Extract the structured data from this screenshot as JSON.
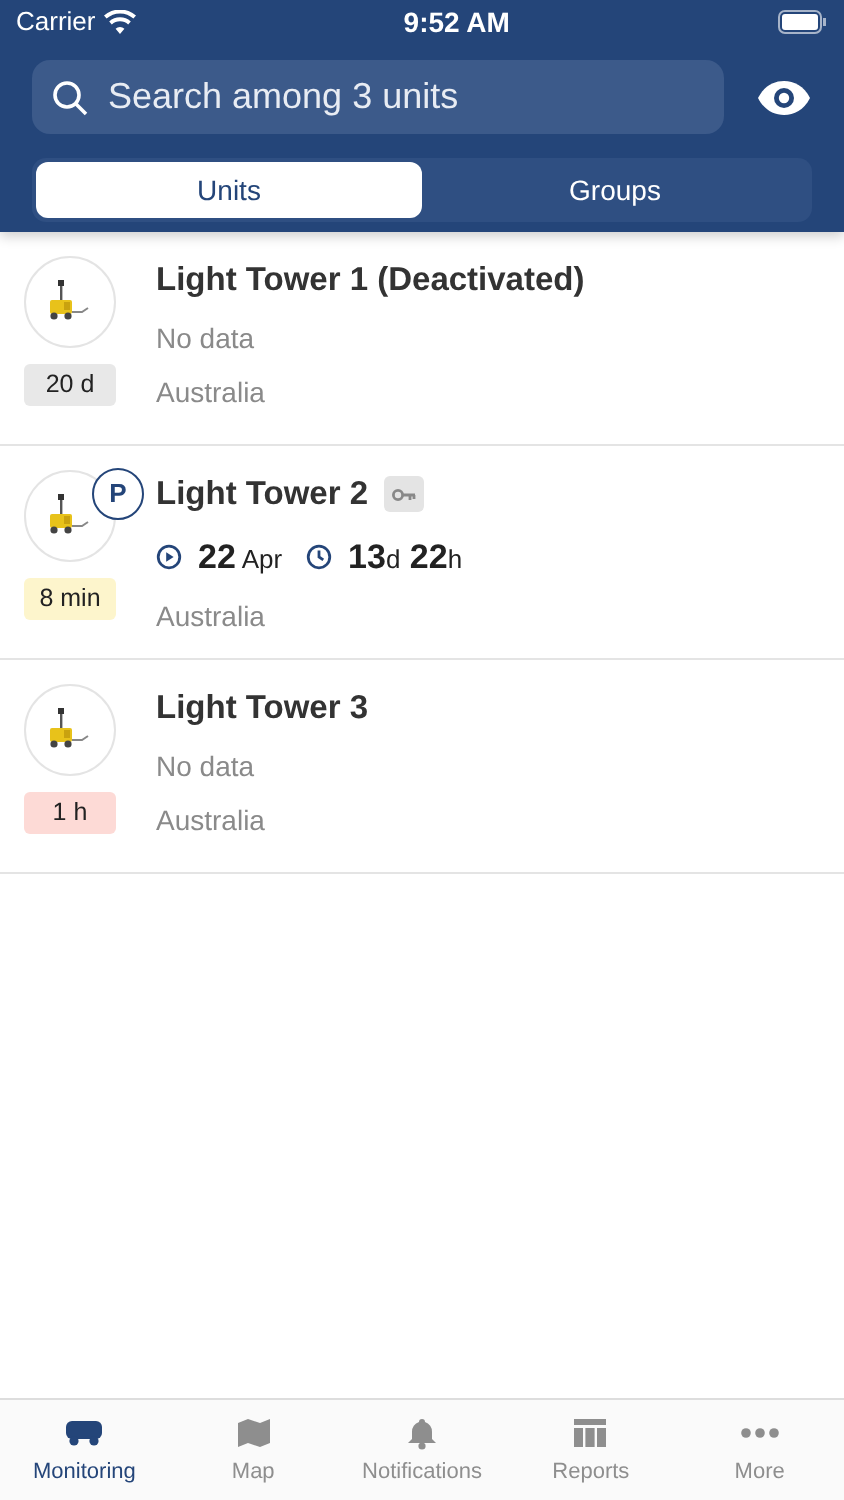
{
  "status_bar": {
    "carrier": "Carrier",
    "time": "9:52 AM"
  },
  "search": {
    "placeholder": "Search among 3 units"
  },
  "tabs": [
    {
      "label": "Units",
      "selected": true
    },
    {
      "label": "Groups",
      "selected": false
    }
  ],
  "units": [
    {
      "name": "Light Tower 1 (Deactivated)",
      "age": "20 d",
      "color": "#e8e8e8",
      "parked": false,
      "key": false,
      "kind": "text",
      "info": "No data",
      "location": "Australia"
    },
    {
      "name": "Light Tower 2",
      "age": "8 min",
      "color": "#fdf5cc",
      "parked": true,
      "parked_label": "P",
      "key": true,
      "kind": "trip",
      "date": {
        "value": "22",
        "unit": "Apr"
      },
      "duration": [
        {
          "value": "13",
          "unit": "d"
        },
        {
          "value": "22",
          "unit": "h"
        }
      ],
      "location": "Australia"
    },
    {
      "name": "Light Tower 3",
      "age": "1 h",
      "color": "#fddad6",
      "parked": false,
      "key": false,
      "kind": "text",
      "info": "No data",
      "location": "Australia"
    }
  ],
  "nav": [
    {
      "label": "Monitoring",
      "selected": true
    },
    {
      "label": "Map",
      "selected": false
    },
    {
      "label": "Notifications",
      "selected": false
    },
    {
      "label": "Reports",
      "selected": false
    },
    {
      "label": "More",
      "selected": false
    }
  ]
}
